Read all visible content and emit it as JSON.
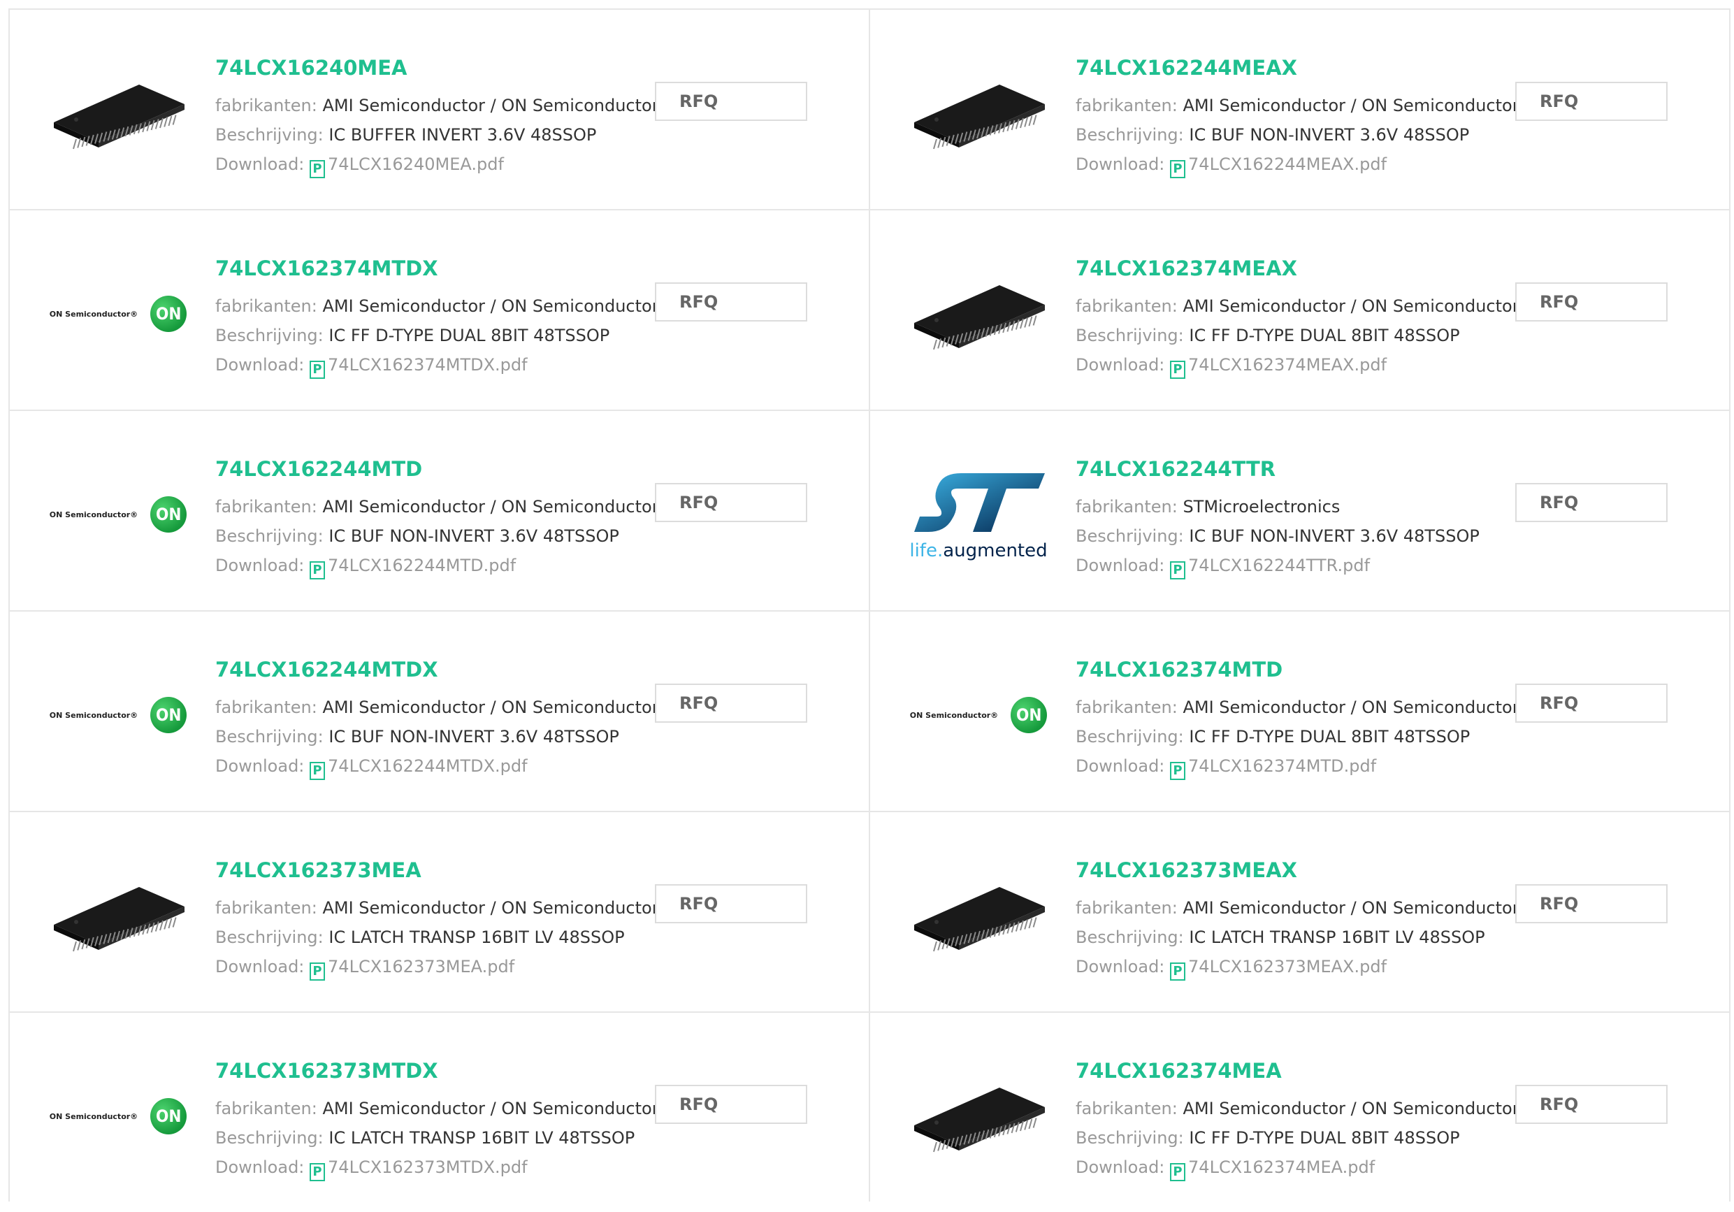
{
  "labels": {
    "manufacturer": "fabrikanten:",
    "description": "Beschrijving:",
    "download": "Download:",
    "rfq": "RFQ",
    "pdf_icon": "P"
  },
  "products": [
    {
      "name": "74LCX16240MEA",
      "manufacturer": "AMI Semiconductor / ON Semiconductor",
      "description": "IC BUFFER INVERT 3.6V 48SSOP",
      "pdf": "74LCX16240MEA.pdf",
      "image": "chip"
    },
    {
      "name": "74LCX162244MEAX",
      "manufacturer": "AMI Semiconductor / ON Semiconductor",
      "description": "IC BUF NON-INVERT 3.6V 48SSOP",
      "pdf": "74LCX162244MEAX.pdf",
      "image": "chip"
    },
    {
      "name": "74LCX162374MTDX",
      "manufacturer": "AMI Semiconductor / ON Semiconductor",
      "description": "IC FF D-TYPE DUAL 8BIT 48TSSOP",
      "pdf": "74LCX162374MTDX.pdf",
      "image": "on-logo"
    },
    {
      "name": "74LCX162374MEAX",
      "manufacturer": "AMI Semiconductor / ON Semiconductor",
      "description": "IC FF D-TYPE DUAL 8BIT 48SSOP",
      "pdf": "74LCX162374MEAX.pdf",
      "image": "chip"
    },
    {
      "name": "74LCX162244MTD",
      "manufacturer": "AMI Semiconductor / ON Semiconductor",
      "description": "IC BUF NON-INVERT 3.6V 48TSSOP",
      "pdf": "74LCX162244MTD.pdf",
      "image": "on-logo"
    },
    {
      "name": "74LCX162244TTR",
      "manufacturer": "STMicroelectronics",
      "description": "IC BUF NON-INVERT 3.6V 48TSSOP",
      "pdf": "74LCX162244TTR.pdf",
      "image": "st-logo"
    },
    {
      "name": "74LCX162244MTDX",
      "manufacturer": "AMI Semiconductor / ON Semiconductor",
      "description": "IC BUF NON-INVERT 3.6V 48TSSOP",
      "pdf": "74LCX162244MTDX.pdf",
      "image": "on-logo"
    },
    {
      "name": "74LCX162374MTD",
      "manufacturer": "AMI Semiconductor / ON Semiconductor",
      "description": "IC FF D-TYPE DUAL 8BIT 48TSSOP",
      "pdf": "74LCX162374MTD.pdf",
      "image": "on-logo"
    },
    {
      "name": "74LCX162373MEA",
      "manufacturer": "AMI Semiconductor / ON Semiconductor",
      "description": "IC LATCH TRANSP 16BIT LV 48SSOP",
      "pdf": "74LCX162373MEA.pdf",
      "image": "chip"
    },
    {
      "name": "74LCX162373MEAX",
      "manufacturer": "AMI Semiconductor / ON Semiconductor",
      "description": "IC LATCH TRANSP 16BIT LV 48SSOP",
      "pdf": "74LCX162373MEAX.pdf",
      "image": "chip"
    },
    {
      "name": "74LCX162373MTDX",
      "manufacturer": "AMI Semiconductor / ON Semiconductor",
      "description": "IC LATCH TRANSP 16BIT LV 48TSSOP",
      "pdf": "74LCX162373MTDX.pdf",
      "image": "on-logo"
    },
    {
      "name": "74LCX162374MEA",
      "manufacturer": "AMI Semiconductor / ON Semiconductor",
      "description": "IC FF D-TYPE DUAL 8BIT 48SSOP",
      "pdf": "74LCX162374MEA.pdf",
      "image": "chip"
    }
  ],
  "logos": {
    "on_text": "ON Semiconductor®",
    "on_mark": "ON",
    "st_tag_1": "life.",
    "st_tag_2": "augmented"
  },
  "colors": {
    "accent": "#1fbf8f",
    "label": "#999999",
    "value": "#333333",
    "border": "#e6e6e6",
    "on_green": "#169a3c",
    "st_blue": "#03234b",
    "st_light": "#3cb4e6"
  }
}
